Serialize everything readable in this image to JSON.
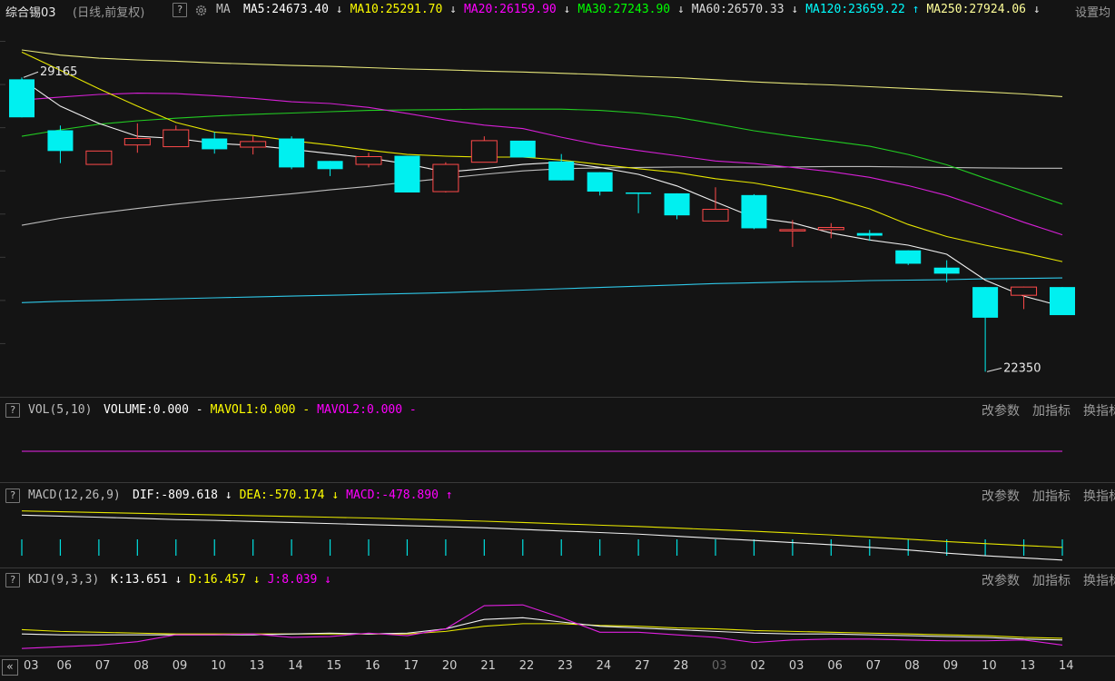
{
  "header": {
    "title": "综合锡03",
    "period": "(日线,前复权)",
    "help": "?",
    "gear_icon": "gear-icon",
    "ma_label": "MA",
    "ma_items": [
      {
        "label": "MA5:24673.40",
        "arrow": "↓",
        "color": "#ffffff"
      },
      {
        "label": "MA10:25291.70",
        "arrow": "↓",
        "color": "#ffff00"
      },
      {
        "label": "MA20:26159.90",
        "arrow": "↓",
        "color": "#ff00ff"
      },
      {
        "label": "MA30:27243.90",
        "arrow": "↓",
        "color": "#00ff00"
      },
      {
        "label": "MA60:26570.33",
        "arrow": "↓",
        "color": "#dddddd"
      },
      {
        "label": "MA120:23659.22",
        "arrow": "↑",
        "color": "#00ffff"
      },
      {
        "label": "MA250:27924.06",
        "arrow": "↓",
        "color": "#ffff99"
      }
    ],
    "settings": "设置均"
  },
  "panes": {
    "vol": {
      "help": "?",
      "name": "VOL(5,10)",
      "items": [
        {
          "label": "VOLUME:0.000",
          "suffix": " -",
          "color": "#ffffff"
        },
        {
          "label": "MAVOL1:0.000",
          "suffix": " -",
          "color": "#ffff00"
        },
        {
          "label": "MAVOL2:0.000",
          "suffix": " -",
          "color": "#ff00ff"
        }
      ]
    },
    "macd": {
      "help": "?",
      "name": "MACD(12,26,9)",
      "items": [
        {
          "label": "DIF:-809.618",
          "suffix": " ↓",
          "color": "#ffffff"
        },
        {
          "label": "DEA:-570.174",
          "suffix": " ↓",
          "color": "#ffff00"
        },
        {
          "label": "MACD:-478.890",
          "suffix": " ↑",
          "color": "#ff00ff"
        }
      ]
    },
    "kdj": {
      "help": "?",
      "name": "KDJ(9,3,3)",
      "items": [
        {
          "label": "K:13.651",
          "suffix": " ↓",
          "color": "#ffffff"
        },
        {
          "label": "D:16.457",
          "suffix": " ↓",
          "color": "#ffff00"
        },
        {
          "label": "J:8.039",
          "suffix": " ↓",
          "color": "#ff00ff"
        }
      ]
    },
    "buttons": {
      "change_params": "改参数",
      "add_indicator": "加指标",
      "switch_indicator": "换指标"
    }
  },
  "chart_data": {
    "type": "candlestick",
    "x": [
      "03",
      "06",
      "07",
      "08",
      "09",
      "10",
      "13",
      "14",
      "15",
      "16",
      "17",
      "20",
      "21",
      "22",
      "23",
      "24",
      "27",
      "28",
      "03",
      "02",
      "03",
      "06",
      "07",
      "08",
      "09",
      "10",
      "13",
      "14"
    ],
    "x_dim": [
      false,
      false,
      false,
      false,
      false,
      false,
      false,
      false,
      false,
      false,
      false,
      false,
      false,
      false,
      false,
      false,
      false,
      false,
      true,
      false,
      false,
      false,
      false,
      false,
      false,
      false,
      false,
      false
    ],
    "candles": [
      {
        "o": 29120,
        "h": 29165,
        "l": 28240,
        "c": 28240
      },
      {
        "o": 27940,
        "h": 28050,
        "l": 27180,
        "c": 27460
      },
      {
        "o": 27150,
        "h": 27460,
        "l": 27150,
        "c": 27460
      },
      {
        "o": 27600,
        "h": 28100,
        "l": 27420,
        "c": 27750
      },
      {
        "o": 27560,
        "h": 28050,
        "l": 27560,
        "c": 27950
      },
      {
        "o": 27750,
        "h": 27900,
        "l": 27400,
        "c": 27500
      },
      {
        "o": 27550,
        "h": 27800,
        "l": 27380,
        "c": 27680
      },
      {
        "o": 27750,
        "h": 27800,
        "l": 27040,
        "c": 27080
      },
      {
        "o": 27230,
        "h": 27230,
        "l": 26880,
        "c": 27040
      },
      {
        "o": 27150,
        "h": 27420,
        "l": 27080,
        "c": 27330
      },
      {
        "o": 27350,
        "h": 27350,
        "l": 26500,
        "c": 26500
      },
      {
        "o": 26520,
        "h": 27200,
        "l": 26500,
        "c": 27150
      },
      {
        "o": 27200,
        "h": 27800,
        "l": 27200,
        "c": 27700
      },
      {
        "o": 27700,
        "h": 27700,
        "l": 27310,
        "c": 27310
      },
      {
        "o": 27220,
        "h": 27390,
        "l": 26780,
        "c": 26780
      },
      {
        "o": 26970,
        "h": 26970,
        "l": 26430,
        "c": 26520
      },
      {
        "o": 26500,
        "h": 26500,
        "l": 26020,
        "c": 26480
      },
      {
        "o": 26480,
        "h": 26480,
        "l": 25880,
        "c": 25970
      },
      {
        "o": 25840,
        "h": 26620,
        "l": 25840,
        "c": 26110
      },
      {
        "o": 26440,
        "h": 26460,
        "l": 25650,
        "c": 25670
      },
      {
        "o": 25640,
        "h": 25860,
        "l": 25240,
        "c": 25640
      },
      {
        "o": 25640,
        "h": 25790,
        "l": 25440,
        "c": 25690
      },
      {
        "o": 25560,
        "h": 25630,
        "l": 25380,
        "c": 25500
      },
      {
        "o": 25160,
        "h": 25160,
        "l": 24820,
        "c": 24850
      },
      {
        "o": 24760,
        "h": 24930,
        "l": 24420,
        "c": 24620
      },
      {
        "o": 24310,
        "h": 24310,
        "l": 22350,
        "c": 23600
      },
      {
        "o": 24120,
        "h": 24320,
        "l": 23800,
        "c": 24310
      },
      {
        "o": 24310,
        "h": 24310,
        "l": 23660,
        "c": 23660
      }
    ],
    "ma5": [
      29120,
      28500,
      28100,
      27800,
      27750,
      27640,
      27590,
      27500,
      27400,
      27300,
      27160,
      26970,
      27050,
      27150,
      27200,
      27080,
      26920,
      26650,
      26280,
      25920,
      25800,
      25560,
      25400,
      25280,
      25070,
      24470,
      24100,
      23860
    ],
    "ma10": [
      29750,
      29330,
      28900,
      28500,
      28120,
      27900,
      27820,
      27700,
      27600,
      27480,
      27380,
      27340,
      27320,
      27320,
      27250,
      27150,
      27050,
      26960,
      26820,
      26720,
      26560,
      26380,
      26120,
      25760,
      25480,
      25280,
      25100,
      24900
    ],
    "ma20": [
      28640,
      28710,
      28770,
      28800,
      28790,
      28740,
      28680,
      28600,
      28560,
      28470,
      28330,
      28180,
      28060,
      27980,
      27780,
      27600,
      27470,
      27350,
      27230,
      27170,
      27080,
      26980,
      26850,
      26660,
      26430,
      26130,
      25810,
      25520
    ],
    "ma30": [
      27800,
      27950,
      28080,
      28160,
      28220,
      28270,
      28310,
      28340,
      28370,
      28400,
      28410,
      28420,
      28430,
      28430,
      28430,
      28400,
      28340,
      28240,
      28090,
      27930,
      27800,
      27690,
      27570,
      27380,
      27140,
      26830,
      26530,
      26230
    ],
    "ma60": [
      25740,
      25900,
      26020,
      26130,
      26230,
      26320,
      26390,
      26470,
      26560,
      26640,
      26740,
      26830,
      26920,
      27000,
      27050,
      27070,
      27080,
      27090,
      27090,
      27090,
      27090,
      27100,
      27100,
      27090,
      27080,
      27070,
      27060,
      27060
    ],
    "ma120": [
      23950,
      23980,
      24000,
      24020,
      24040,
      24060,
      24080,
      24100,
      24120,
      24140,
      24160,
      24180,
      24210,
      24240,
      24270,
      24300,
      24330,
      24360,
      24390,
      24410,
      24430,
      24440,
      24460,
      24470,
      24480,
      24500,
      24510,
      24520
    ],
    "ma250": [
      29800,
      29680,
      29610,
      29570,
      29540,
      29500,
      29470,
      29440,
      29420,
      29390,
      29360,
      29340,
      29310,
      29290,
      29260,
      29230,
      29190,
      29160,
      29110,
      29060,
      29020,
      28990,
      28950,
      28910,
      28870,
      28830,
      28780,
      28720
    ],
    "ylim": [
      22000,
      30200
    ],
    "annotations": [
      {
        "label": "29165",
        "index": 0,
        "value": 29165
      },
      {
        "label": "22350",
        "index": 25,
        "value": 22350
      }
    ],
    "vol": {
      "mavol2": [
        0,
        0,
        0,
        0,
        0,
        0,
        0,
        0,
        0,
        0,
        0,
        0,
        0,
        0,
        0,
        0,
        0,
        0,
        0,
        0,
        0,
        0,
        0,
        0,
        0,
        0,
        0,
        0
      ]
    },
    "macd": {
      "dif": [
        40,
        20,
        0,
        -20,
        -45,
        -60,
        -80,
        -100,
        -120,
        -140,
        -160,
        -180,
        -200,
        -230,
        -260,
        -290,
        -320,
        -360,
        -400,
        -440,
        -480,
        -520,
        -570,
        -620,
        -680,
        -730,
        -770,
        -810
      ],
      "dea": [
        120,
        105,
        90,
        75,
        60,
        45,
        30,
        15,
        0,
        -15,
        -35,
        -55,
        -75,
        -100,
        -125,
        -150,
        -175,
        -205,
        -235,
        -265,
        -300,
        -335,
        -375,
        -415,
        -460,
        -500,
        -535,
        -570
      ],
      "bar": [
        -155,
        -155,
        -155,
        -155,
        -155,
        -155,
        -155,
        -155,
        -155,
        -155,
        -155,
        -155,
        -155,
        -155,
        -155,
        -155,
        -155,
        -155,
        -155,
        -155,
        -155,
        -155,
        -155,
        -155,
        -155,
        -155,
        -155,
        -155
      ],
      "ylim": [
        -900,
        200
      ]
    },
    "kdj": {
      "k": [
        21,
        20,
        20,
        20,
        20,
        20,
        20,
        21,
        22,
        21,
        22,
        27,
        38,
        40,
        35,
        30,
        28,
        26,
        24,
        22,
        21,
        21,
        20,
        19,
        18,
        17,
        15,
        14
      ],
      "d": [
        26,
        24,
        23,
        22,
        21,
        21,
        21,
        21,
        21,
        21,
        21,
        24,
        30,
        33,
        33,
        31,
        30,
        28,
        27,
        25,
        24,
        23,
        22,
        21,
        20,
        19,
        17,
        16
      ],
      "j": [
        4,
        6,
        8,
        12,
        20,
        20,
        21,
        17,
        18,
        22,
        19,
        27,
        54,
        55,
        40,
        23,
        23,
        20,
        17,
        11,
        14,
        15,
        15,
        14,
        13,
        13,
        14,
        8
      ],
      "ylim": [
        0,
        70
      ]
    }
  }
}
